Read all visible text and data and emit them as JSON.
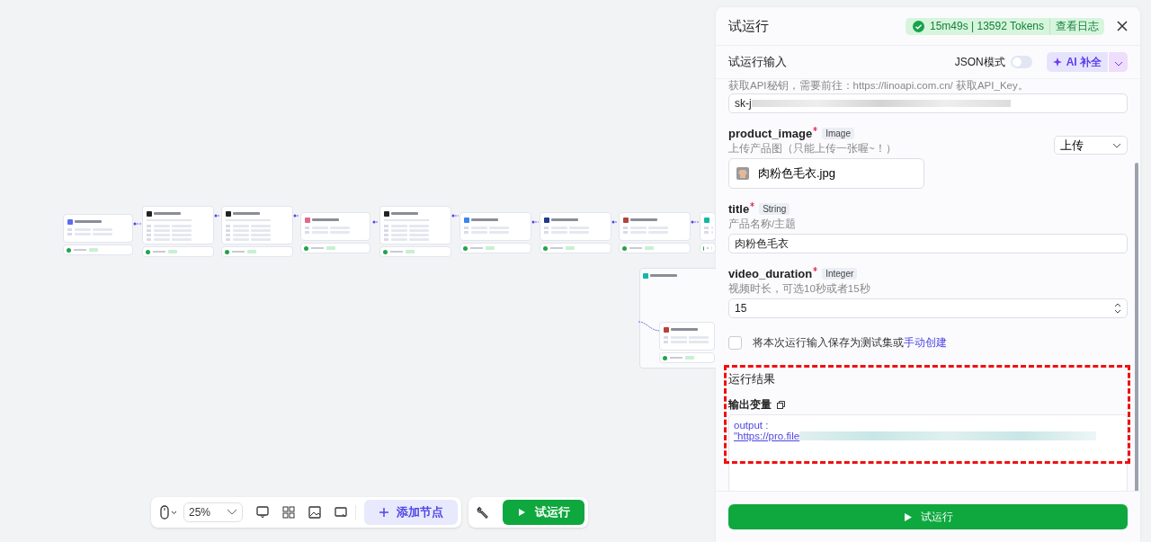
{
  "canvas": {
    "nodes": [
      {
        "color": "#5b6cf0",
        "tall": false
      },
      {
        "color": "#222222",
        "tall": true
      },
      {
        "color": "#222222",
        "tall": true
      },
      {
        "color": "#e2688a",
        "tall": false
      },
      {
        "color": "#222222",
        "tall": true
      },
      {
        "color": "#3b82f6",
        "tall": false
      },
      {
        "color": "#1e3a8a",
        "tall": false
      },
      {
        "color": "#b4443a",
        "tall": false
      },
      {
        "color": "#14b8a6",
        "tall": false
      }
    ]
  },
  "toolbar": {
    "zoom": "25%",
    "add_node": "添加节点",
    "run": "试运行"
  },
  "panel": {
    "title": "试运行",
    "status": "15m49s | 13592 Tokens",
    "log_link": "查看日志",
    "input_section": {
      "title": "试运行输入",
      "json_mode_label": "JSON模式",
      "json_mode": false,
      "ai_button": "AI 补全"
    },
    "fields": [
      {
        "kind": "text",
        "hint": "获取API秘钥，需要前往：https://linoapi.com.cn/ 获取API_Key。",
        "value": "sk-j",
        "blurred": true
      },
      {
        "kind": "upload",
        "name": "product_image",
        "required": true,
        "type": "Image",
        "hint": "上传产品图（只能上传一张喔~！）",
        "mode": "上传",
        "file": "肉粉色毛衣.jpg"
      },
      {
        "kind": "text",
        "name": "title",
        "required": true,
        "type": "String",
        "hint": "产品名称/主题",
        "value": "肉粉色毛衣",
        "blurred": false
      },
      {
        "kind": "number",
        "name": "video_duration",
        "required": true,
        "type": "Integer",
        "hint": "视频时长，可选10秒或者15秒",
        "value": "15"
      }
    ],
    "save": {
      "checked": false,
      "label": "将本次运行输入保存为测试集或",
      "link": "手动创建"
    },
    "results": {
      "title": "运行结果",
      "output_title": "输出变量",
      "key": "output :",
      "value": "\"https://pro.file"
    },
    "run_button": "试运行"
  }
}
